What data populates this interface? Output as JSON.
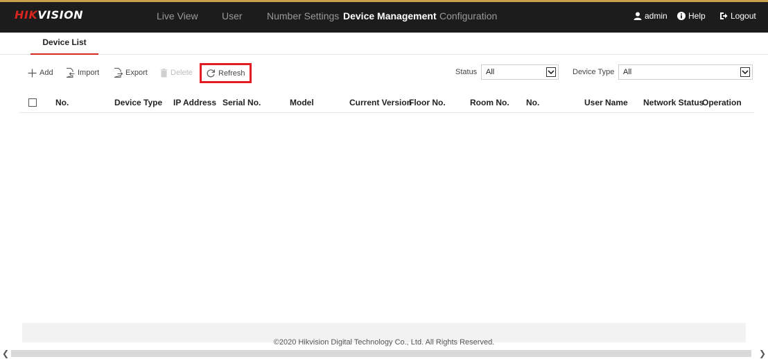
{
  "app": {
    "logo_red": "HIK",
    "logo_white": "VISION"
  },
  "nav": {
    "items": [
      {
        "label": "Live View"
      },
      {
        "label": "User"
      },
      {
        "label": "Number Settings"
      },
      {
        "label": "Device Management",
        "active": true
      },
      {
        "label": "Configuration"
      }
    ]
  },
  "user_menu": {
    "user": "admin",
    "help": "Help",
    "logout": "Logout"
  },
  "tabs": [
    {
      "label": "Device List",
      "active": true
    }
  ],
  "toolbar": {
    "add": "Add",
    "import": "Import",
    "export": "Export",
    "delete": "Delete",
    "refresh": "Refresh"
  },
  "filters": {
    "status_label": "Status",
    "status_value": "All",
    "device_type_label": "Device Type",
    "device_type_value": "All"
  },
  "table": {
    "columns": [
      "No.",
      "Device Type",
      "IP Address",
      "Serial No.",
      "Model",
      "Current Version",
      "Floor No.",
      "Room No.",
      "No.",
      "User Name",
      "Network Status",
      "Operation"
    ],
    "rows": []
  },
  "footer": {
    "copyright": "©2020 Hikvision Digital Technology Co., Ltd. All Rights Reserved."
  },
  "colors": {
    "brand_red": "#d7261f",
    "highlight_red": "#e31b23",
    "topbar_bg": "#1c1c1c",
    "accent_gold": "#c8a04a"
  },
  "icons": {
    "add": "plus-icon",
    "import": "import-icon",
    "export": "export-icon",
    "delete": "trash-icon",
    "refresh": "refresh-icon",
    "user": "user-icon",
    "help": "info-icon",
    "logout": "logout-icon",
    "dropdown": "chevron-down-icon",
    "scroll_left": "chevron-left-icon",
    "scroll_right": "chevron-right-icon"
  }
}
